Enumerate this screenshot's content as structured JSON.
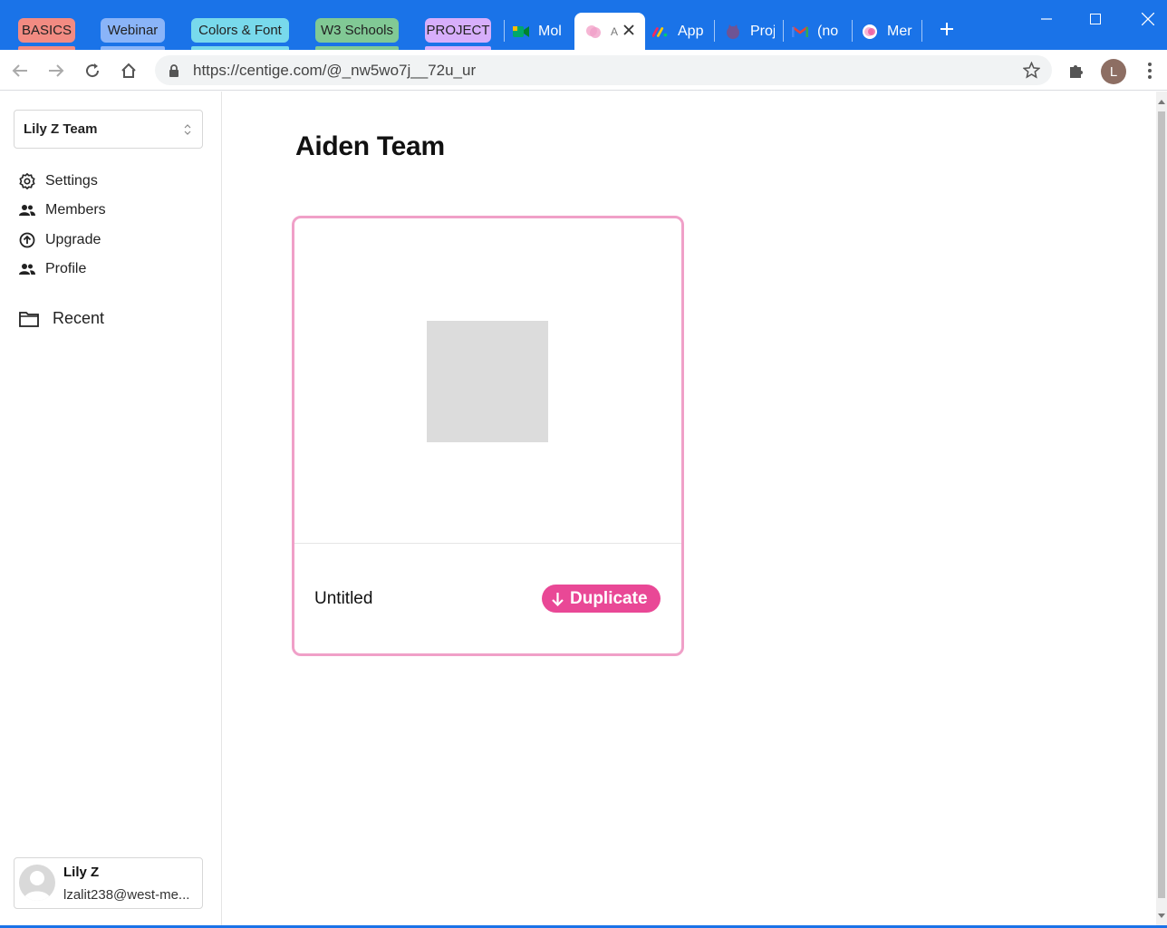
{
  "browser": {
    "tab_groups": [
      {
        "label": "BASICS",
        "color": "#f28b82"
      },
      {
        "label": "Webinar",
        "color": "#8ab4f8"
      },
      {
        "label": "Colors & Font",
        "color": "#78d9ec"
      },
      {
        "label": "W3 Schools",
        "color": "#81c995"
      },
      {
        "label": "PROJECT",
        "color": "#d7aefb"
      }
    ],
    "tabs": [
      {
        "label": "Mol",
        "icon": "meet-icon"
      },
      {
        "label": "A",
        "icon": "centige-icon"
      },
      {
        "label": "App",
        "icon": "monday-icon"
      },
      {
        "label": "Proj",
        "icon": "github-icon"
      },
      {
        "label": "(no",
        "icon": "gmail-icon"
      },
      {
        "label": "Mer",
        "icon": "centige-icon"
      }
    ],
    "url": "https://centige.com/@_nw5wo7j__72u_ur",
    "profile_initial": "L",
    "accent": "#1a73e8"
  },
  "sidebar": {
    "team_select": "Lily Z Team",
    "nav": [
      {
        "label": "Settings",
        "icon": "gear-icon"
      },
      {
        "label": "Members",
        "icon": "people-icon"
      },
      {
        "label": "Upgrade",
        "icon": "upgrade-icon"
      },
      {
        "label": "Profile",
        "icon": "people-icon"
      }
    ],
    "recent_label": "Recent",
    "user": {
      "name": "Lily Z",
      "email": "lzalit238@west-me..."
    }
  },
  "main": {
    "title": "Aiden Team",
    "card": {
      "name": "Untitled",
      "duplicate_label": "Duplicate",
      "border_color": "#f0a0c8",
      "button_color": "#e94896"
    }
  }
}
